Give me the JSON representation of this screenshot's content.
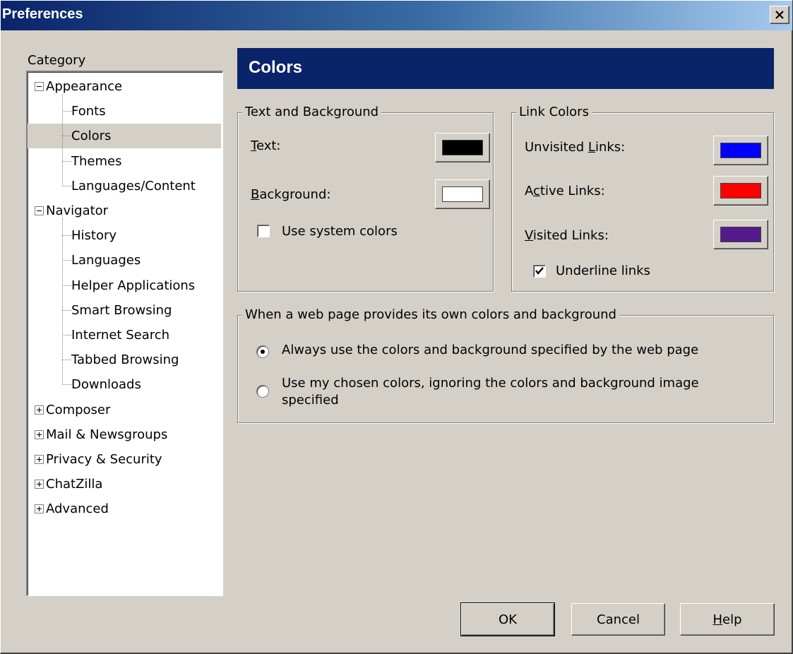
{
  "window": {
    "title": "Preferences",
    "close_glyph": "close-icon"
  },
  "category": {
    "label": "Category",
    "tree": [
      {
        "label": "Appearance",
        "kind": "top",
        "expander": "minus"
      },
      {
        "label": "Fonts",
        "kind": "child"
      },
      {
        "label": "Colors",
        "kind": "child",
        "selected": true
      },
      {
        "label": "Themes",
        "kind": "child"
      },
      {
        "label": "Languages/Content",
        "kind": "child"
      },
      {
        "label": "Navigator",
        "kind": "top",
        "expander": "minus"
      },
      {
        "label": "History",
        "kind": "child"
      },
      {
        "label": "Languages",
        "kind": "child"
      },
      {
        "label": "Helper Applications",
        "kind": "child"
      },
      {
        "label": "Smart Browsing",
        "kind": "child"
      },
      {
        "label": "Internet Search",
        "kind": "child"
      },
      {
        "label": "Tabbed Browsing",
        "kind": "child"
      },
      {
        "label": "Downloads",
        "kind": "child"
      },
      {
        "label": "Composer",
        "kind": "top",
        "expander": "plus"
      },
      {
        "label": "Mail & Newsgroups",
        "kind": "top",
        "expander": "plus"
      },
      {
        "label": "Privacy & Security",
        "kind": "top",
        "expander": "plus"
      },
      {
        "label": "ChatZilla",
        "kind": "top",
        "expander": "plus"
      },
      {
        "label": "Advanced",
        "kind": "top",
        "expander": "plus"
      }
    ]
  },
  "panel": {
    "title": "Colors",
    "text_bg": {
      "title": "Text and Background",
      "text_label_accel": "T",
      "text_label_rest": "ext:",
      "text_color": "#000000",
      "bg_label_accel": "B",
      "bg_label_rest": "ackground:",
      "bg_color": "#ffffff",
      "system_colors_label": "Use system colors",
      "system_colors_checked": false
    },
    "link_colors": {
      "title": "Link Colors",
      "unvisited_pre": "Unvisited ",
      "unvisited_accel": "L",
      "unvisited_post": "inks:",
      "unvisited_color": "#0000ff",
      "active_pre": "A",
      "active_accel": "c",
      "active_post": "tive Links:",
      "active_color": "#ff0000",
      "visited_accel": "V",
      "visited_post": "isited Links:",
      "visited_color": "#551a8b",
      "underline_label": "Underline links",
      "underline_checked": true
    },
    "override": {
      "title": "When a web page provides its own colors and background",
      "option1": "Always use the colors and background specified by the web page",
      "option2_line1": "Use my chosen colors, ignoring the colors and background image",
      "option2_line2": "specified",
      "selected": 1
    }
  },
  "buttons": {
    "ok": "OK",
    "cancel": "Cancel",
    "help_accel": "H",
    "help_rest": "elp"
  }
}
